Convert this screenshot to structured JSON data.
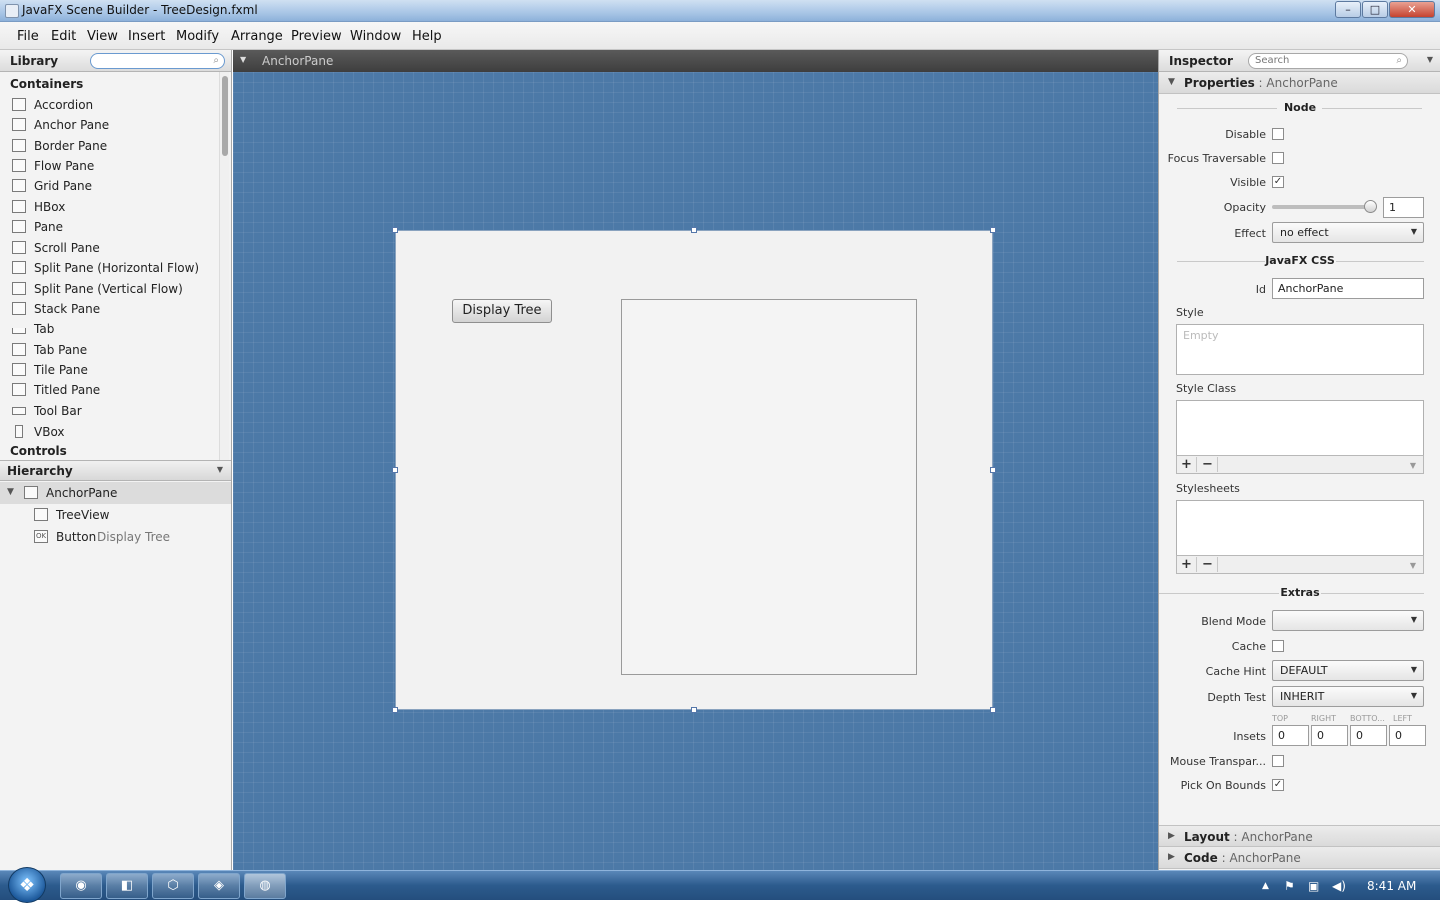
{
  "window": {
    "title": "JavaFX Scene Builder - TreeDesign.fxml",
    "minimize": "–",
    "maximize": "□",
    "close": "✕"
  },
  "menu": [
    "File",
    "Edit",
    "View",
    "Insert",
    "Modify",
    "Arrange",
    "Preview",
    "Window",
    "Help"
  ],
  "library": {
    "title": "Library",
    "search_placeholder": "",
    "sections": {
      "containers": "Containers",
      "controls": "Controls"
    },
    "items": [
      "Accordion",
      "Anchor Pane",
      "Border Pane",
      "Flow Pane",
      "Grid Pane",
      "HBox",
      "Pane",
      "Scroll Pane",
      "Split Pane (Horizontal Flow)",
      "Split Pane (Vertical Flow)",
      "Stack Pane",
      "Tab",
      "Tab Pane",
      "Tile Pane",
      "Titled Pane",
      "Tool Bar",
      "VBox"
    ]
  },
  "hierarchy": {
    "title": "Hierarchy",
    "nodes": [
      {
        "label": "AnchorPane",
        "sub": ""
      },
      {
        "label": "TreeView",
        "sub": ""
      },
      {
        "label": "Button",
        "sub": "Display Tree"
      }
    ]
  },
  "canvas": {
    "breadcrumb": "AnchorPane",
    "button_label": "Display Tree"
  },
  "inspector": {
    "title": "Inspector",
    "search_placeholder": "Search",
    "properties": {
      "label": "Properties",
      "target": " : AnchorPane"
    },
    "node_section": "Node",
    "disable_label": "Disable",
    "focus_label": "Focus Traversable",
    "visible_label": "Visible",
    "visible_checked": true,
    "opacity_label": "Opacity",
    "opacity_value": "1",
    "effect_label": "Effect",
    "effect_value": "no effect",
    "css_section": "JavaFX CSS",
    "id_label": "Id",
    "id_value": "AnchorPane",
    "style_label": "Style",
    "style_placeholder": "Empty",
    "styleclass_label": "Style Class",
    "stylesheets_label": "Stylesheets",
    "plus": "+",
    "minus": "−",
    "extras_section": "Extras",
    "blend_label": "Blend Mode",
    "blend_value": "",
    "cache_label": "Cache",
    "cachehint_label": "Cache Hint",
    "cachehint_value": "DEFAULT",
    "depth_label": "Depth Test",
    "depth_value": "INHERIT",
    "insets_label": "Insets",
    "insets_headers": [
      "TOP",
      "RIGHT",
      "BOTTO...",
      "LEFT"
    ],
    "insets_values": [
      "0",
      "0",
      "0",
      "0"
    ],
    "mouse_label": "Mouse Transpar...",
    "pick_label": "Pick On Bounds",
    "pick_checked": true,
    "layout": {
      "label": "Layout",
      "target": " : AnchorPane"
    },
    "code": {
      "label": "Code",
      "target": " : AnchorPane"
    }
  },
  "taskbar": {
    "clock": "8:41 AM"
  }
}
